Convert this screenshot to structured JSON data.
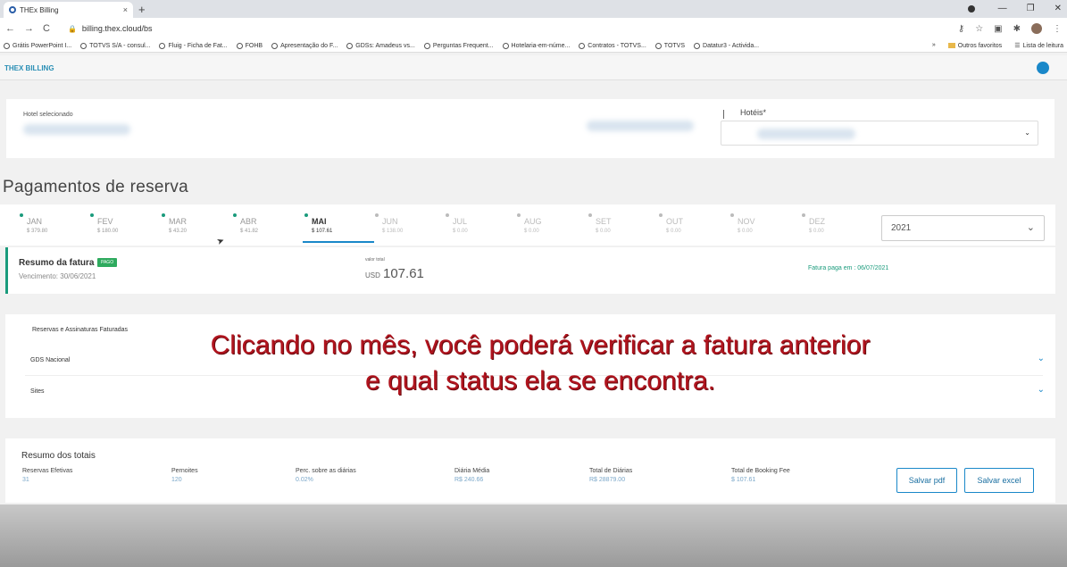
{
  "browser": {
    "tab_title": "THEx Billing",
    "tab_close": "×",
    "new_tab": "+",
    "url": "billing.thex.cloud/bs",
    "bookmarks": [
      "Grátis PowerPoint I...",
      "TOTVS S/A - consul...",
      "Fluig - Ficha de Fat...",
      "FOHB",
      "Apresentação do F...",
      "GDSs: Amadeus vs...",
      "Perguntas Frequent...",
      "Hotelaria-em-núme...",
      "Contratos - TOTVS...",
      "TOTVS",
      "Datatur3 - Activida..."
    ],
    "bookmarks_more": "»",
    "other_favorites": "Outros favoritos",
    "reading_list": "Lista de leitura",
    "nav_back": "←",
    "nav_forward": "→",
    "nav_reload": "C",
    "lock_icon": "🔒",
    "icon_key": "⚷",
    "icon_star": "☆",
    "icon_ext": "▣",
    "icon_puzzle": "✱",
    "icon_menu": "⋮",
    "win_min": "—",
    "win_restore": "❐",
    "win_close": "✕"
  },
  "app": {
    "brand": "THEX BILLING"
  },
  "hotel": {
    "selected_label": "Hotel selecionado",
    "hotels_label": "Hotéis*",
    "select_chevron": "⌄"
  },
  "page_title": "Pagamentos de reserva",
  "months": [
    {
      "name": "JAN",
      "value": "$ 379.80",
      "status": "paid"
    },
    {
      "name": "FEV",
      "value": "$ 180.00",
      "status": "paid"
    },
    {
      "name": "MAR",
      "value": "$ 43.20",
      "status": "paid"
    },
    {
      "name": "ABR",
      "value": "$ 41.82",
      "status": "paid"
    },
    {
      "name": "MAI",
      "value": "$ 107.61",
      "status": "paid",
      "active": true
    },
    {
      "name": "JUN",
      "value": "$ 138.00",
      "status": "pending"
    },
    {
      "name": "JUL",
      "value": "$ 0.00",
      "status": "none"
    },
    {
      "name": "AUG",
      "value": "$ 0.00",
      "status": "none"
    },
    {
      "name": "SET",
      "value": "$ 0.00",
      "status": "none"
    },
    {
      "name": "OUT",
      "value": "$ 0.00",
      "status": "none"
    },
    {
      "name": "NOV",
      "value": "$ 0.00",
      "status": "none"
    },
    {
      "name": "DEZ",
      "value": "$ 0.00",
      "status": "none"
    }
  ],
  "year": {
    "value": "2021",
    "chevron": "⌄"
  },
  "invoice": {
    "title": "Resumo da fatura",
    "badge": "PAGO",
    "due": "Vencimento: 30/06/2021",
    "total_label": "valor total",
    "currency": "USD",
    "total": "107.61",
    "paid_on": "Fatura paga em : 06/07/2021"
  },
  "reservations": {
    "title": "Reservas e Assinaturas Faturadas",
    "rows": [
      "GDS Nacional",
      "Sites"
    ],
    "chevron": "⌄"
  },
  "totals": {
    "title": "Resumo dos totais",
    "columns": [
      {
        "label": "Reservas Efetivas",
        "value": "31"
      },
      {
        "label": "Pernoites",
        "value": "120"
      },
      {
        "label": "Perc. sobre as diárias",
        "value": "0.02%"
      },
      {
        "label": "Diária Média",
        "value": "R$ 240.66"
      },
      {
        "label": "Total de Diárias",
        "value": "R$ 28879.00"
      },
      {
        "label": "Total de Booking Fee",
        "value": "$ 107.61"
      }
    ],
    "save_pdf": "Salvar pdf",
    "save_excel": "Salvar excel"
  },
  "overlay": {
    "line1": "Clicando no mês, você poderá verificar a fatura anterior",
    "line2": "e qual status ela se encontra."
  },
  "colors": {
    "accent": "#1a88c9",
    "paid": "#1a9b7c",
    "badge": "#2eaa5e",
    "overlay_text": "#b0141e"
  }
}
